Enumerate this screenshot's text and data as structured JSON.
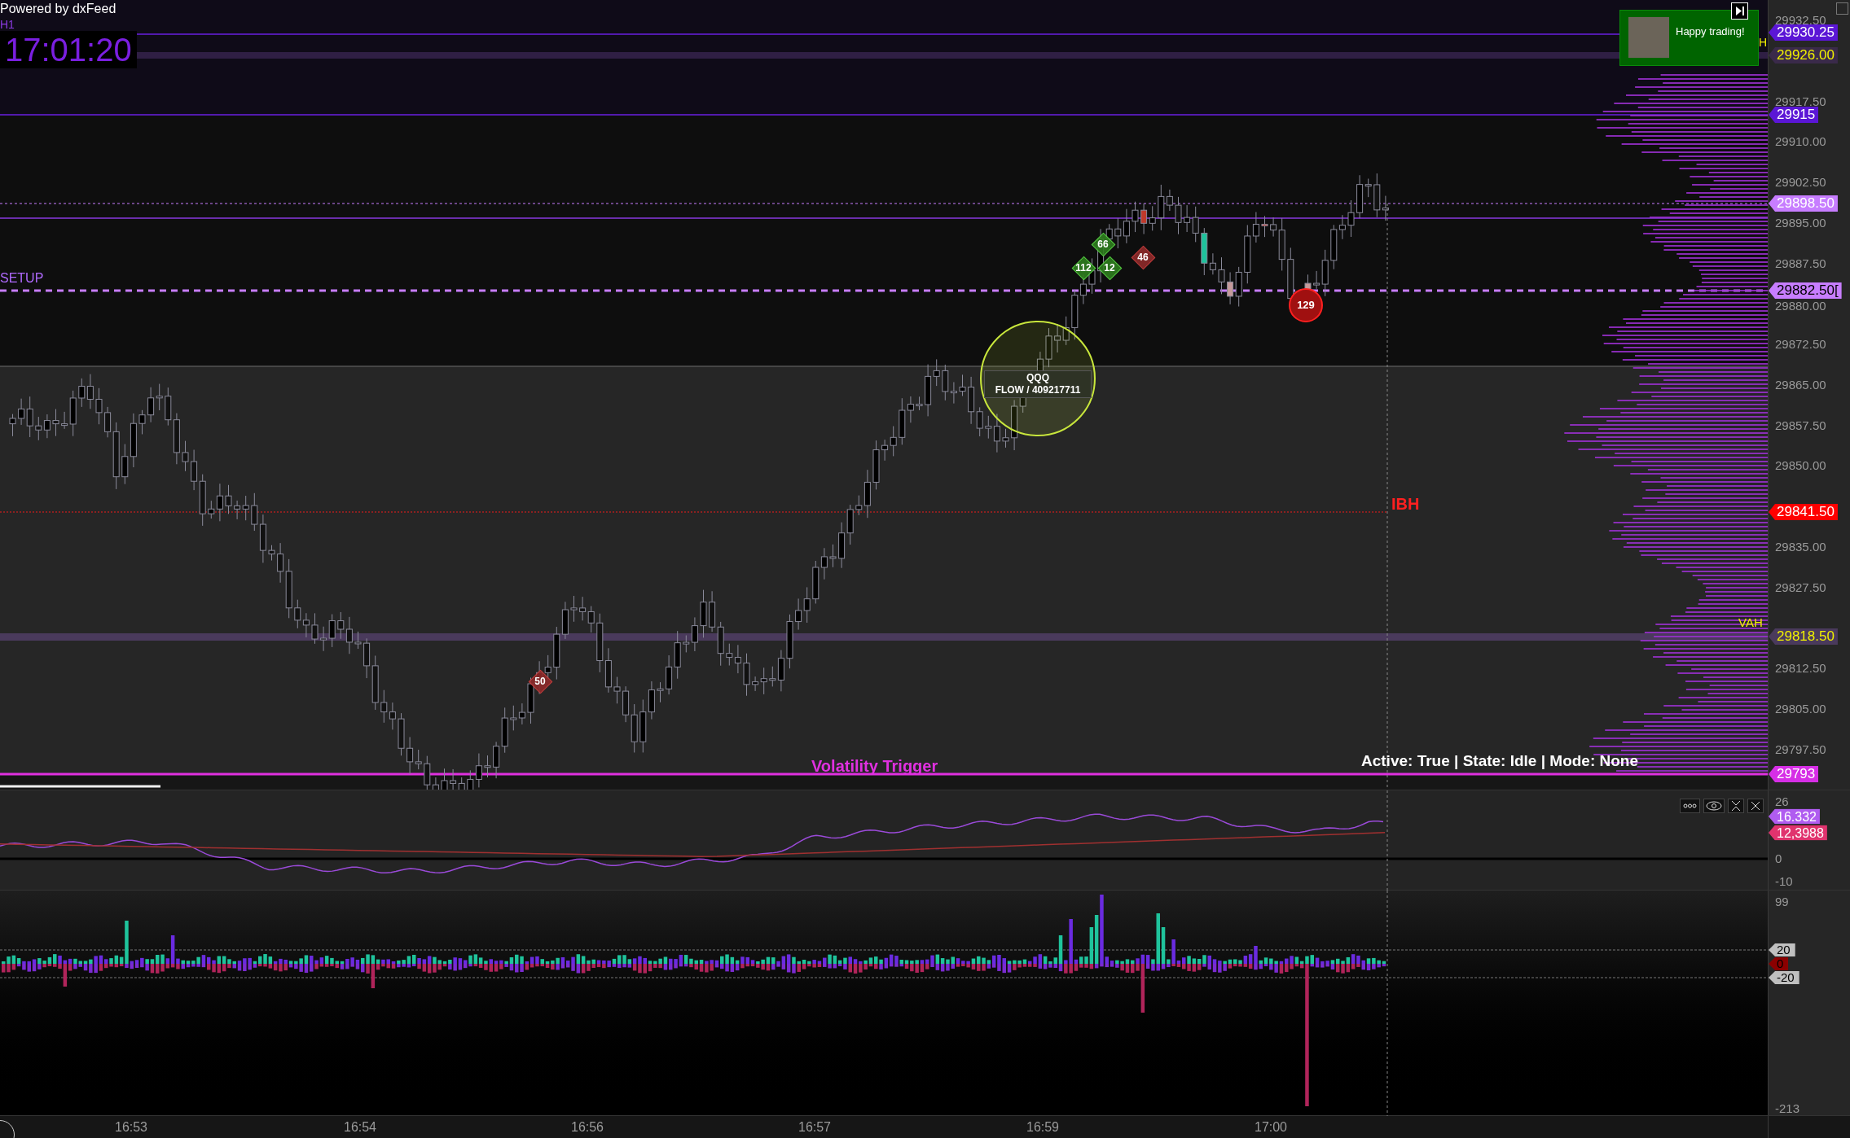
{
  "header": {
    "brand": "Powered by dxFeed",
    "timeframe": "H1",
    "clock": "17:01:20"
  },
  "notification": {
    "message": "Happy trading!"
  },
  "price_panel": {
    "h_label": "H",
    "setup_label": "SETUP",
    "ibh_label": "IBH",
    "vah_label": "VAH",
    "volatility_label": "Volatility Trigger",
    "status": "Active: True | State: Idle | Mode: None",
    "flow_box": {
      "symbol": "QQQ",
      "flow": "FLOW / 409217711"
    },
    "markers": [
      {
        "kind": "buy",
        "label": "66"
      },
      {
        "kind": "buy",
        "label": "112"
      },
      {
        "kind": "buy",
        "label": "12"
      },
      {
        "kind": "sell",
        "label": "46"
      },
      {
        "kind": "sell",
        "label": "50"
      },
      {
        "kind": "big_sell",
        "label": "129"
      }
    ],
    "axis_ticks": [
      "29932.50",
      "29917.50",
      "29910.00",
      "29902.50",
      "29895.00",
      "29887.50",
      "29880.00",
      "29872.50",
      "29865.00",
      "29857.50",
      "29850.00",
      "29835.00",
      "29827.50",
      "29812.50",
      "29805.00",
      "29797.50"
    ],
    "price_tags": [
      {
        "text": "29930.25",
        "color": "#5b16d6",
        "kind": "light"
      },
      {
        "text": "29926.00",
        "color": "#3a2a4a",
        "kind": "yellow"
      },
      {
        "text": "29915",
        "color": "#5b16d6",
        "kind": "light"
      },
      {
        "text": "29898.50",
        "color": "#c77dff",
        "kind": "light"
      },
      {
        "text": "29882.50[",
        "color": "#c77dff",
        "kind": "dark"
      },
      {
        "text": "29841.50",
        "color": "#ff0000",
        "kind": "light"
      },
      {
        "text": "29818.50",
        "color": "#4a3a5c",
        "kind": "yellow"
      },
      {
        "text": "29793",
        "color": "#d62ee6",
        "kind": "light"
      }
    ]
  },
  "oscillator_panel": {
    "axis_ticks": [
      "26",
      "0",
      "-10"
    ],
    "value_tags": [
      {
        "text": "16.332",
        "color": "#b05cf0"
      },
      {
        "text": "12,3988",
        "color": "#e0336e"
      }
    ]
  },
  "histogram_panel": {
    "axis_ticks": [
      "99",
      "-213"
    ],
    "level_tags": [
      {
        "text": "20",
        "kind": "level"
      },
      {
        "text": "0",
        "kind": "value"
      },
      {
        "text": "-20",
        "kind": "level"
      }
    ]
  },
  "time_axis": [
    "16:53",
    "16:54",
    "16:56",
    "16:57",
    "16:59",
    "17:00"
  ]
}
